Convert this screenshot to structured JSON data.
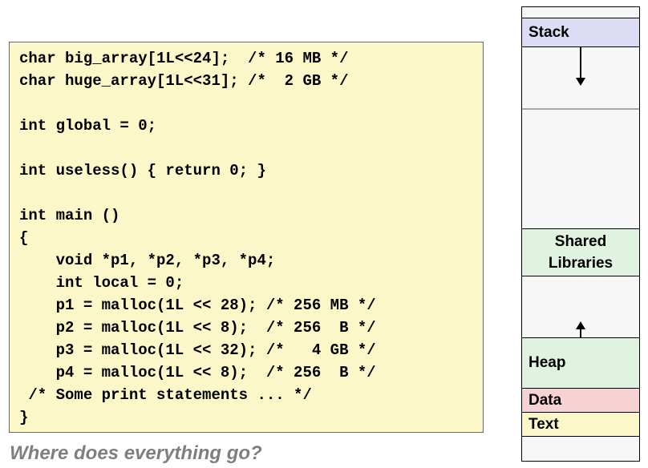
{
  "code": {
    "lines": [
      "char big_array[1L<<24];  /* 16 MB */",
      "char huge_array[1L<<31]; /*  2 GB */",
      "",
      "int global = 0;",
      "",
      "int useless() { return 0; }",
      "",
      "int main ()",
      "{",
      "    void *p1, *p2, *p3, *p4;",
      "    int local = 0;",
      "    p1 = malloc(1L << 28); /* 256 MB */",
      "    p2 = malloc(1L << 8);  /* 256  B */",
      "    p3 = malloc(1L << 32); /*   4 GB */",
      "    p4 = malloc(1L << 8);  /* 256  B */",
      " /* Some print statements ... */",
      "}"
    ]
  },
  "caption": "Where does everything go?",
  "memory": {
    "segments": {
      "stack": "Stack",
      "shared_libraries_1": "Shared",
      "shared_libraries_2": "Libraries",
      "heap": "Heap",
      "data": "Data",
      "text": "Text"
    },
    "colors": {
      "stack": "#dcdcf5",
      "shared_libraries": "#e0f2e0",
      "heap": "#e0f2e0",
      "data": "#f6d2d2",
      "text": "#fbf7c9",
      "empty": "#f7f7f7"
    }
  }
}
